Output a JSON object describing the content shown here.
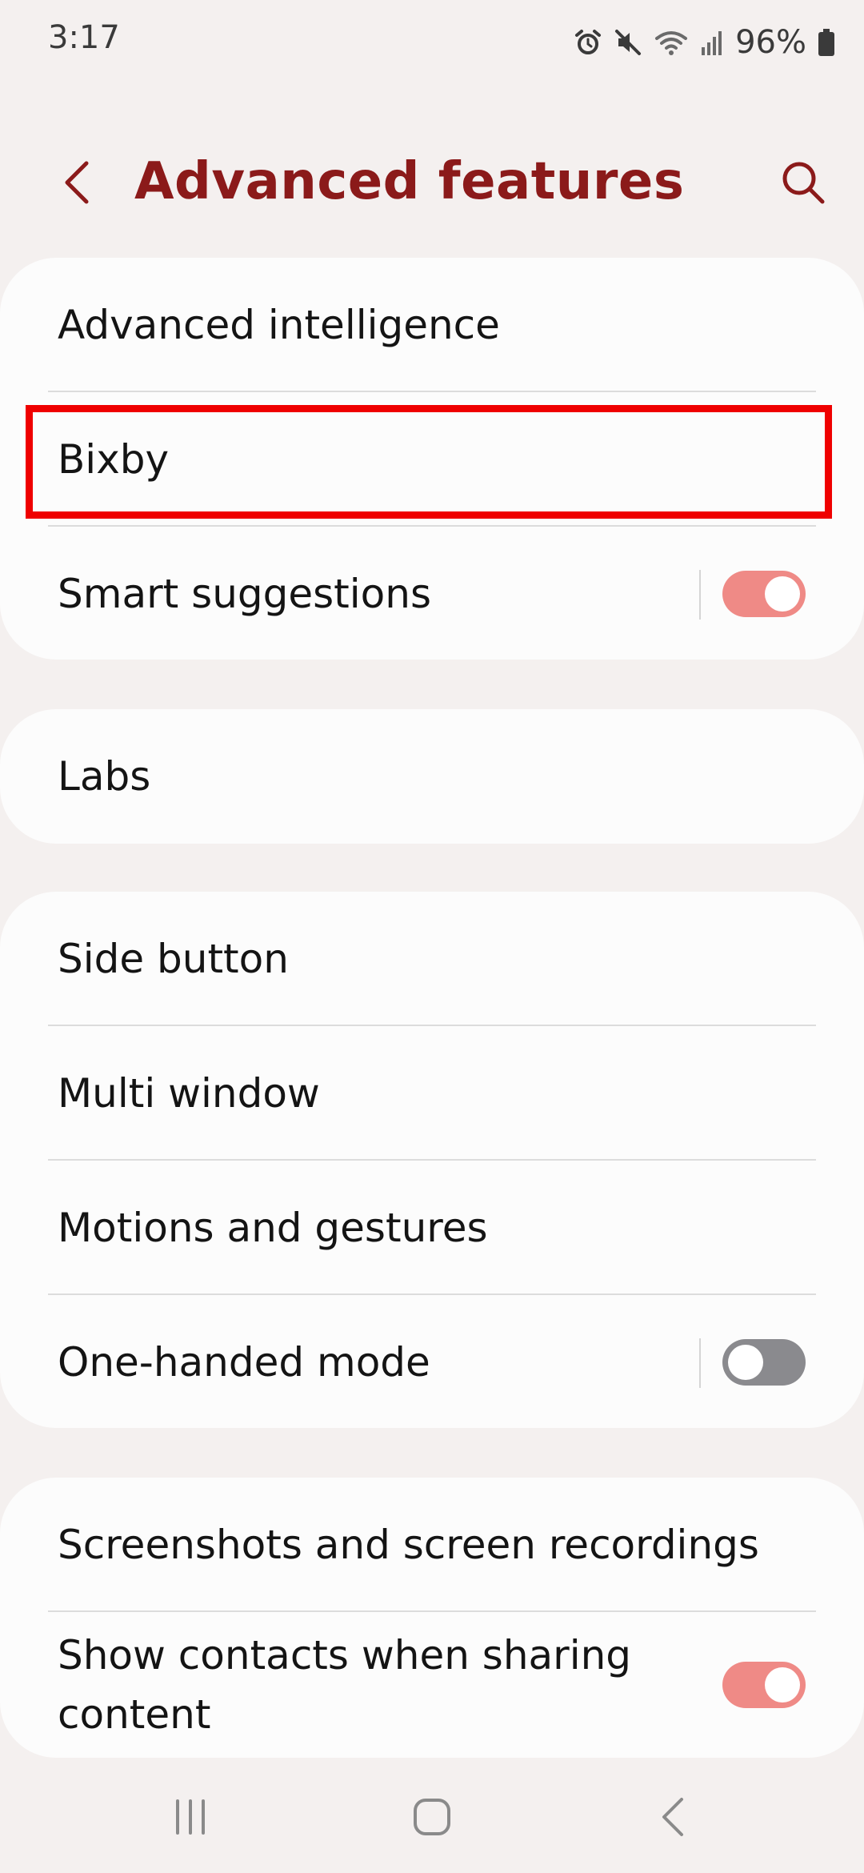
{
  "status_bar": {
    "time": "3:17",
    "battery": "96%",
    "icons": [
      "alarm-icon",
      "mute-icon",
      "wifi-icon",
      "signal-icon",
      "battery-icon"
    ]
  },
  "header": {
    "title": "Advanced features",
    "back_icon": "chevron-left-icon",
    "search_icon": "search-icon"
  },
  "groups": [
    {
      "items": [
        {
          "label": "Advanced intelligence"
        },
        {
          "label": "Bixby",
          "highlighted": true
        },
        {
          "label": "Smart suggestions",
          "toggle": "on"
        }
      ]
    },
    {
      "items": [
        {
          "label": "Labs"
        }
      ]
    },
    {
      "items": [
        {
          "label": "Side button"
        },
        {
          "label": "Multi window"
        },
        {
          "label": "Motions and gestures"
        },
        {
          "label": "One-handed mode",
          "toggle": "off"
        }
      ]
    },
    {
      "items": [
        {
          "label": "Screenshots and screen recordings"
        },
        {
          "label": "Show contacts when sharing content",
          "toggle": "on"
        }
      ]
    }
  ],
  "colors": {
    "accent": "#8b1a1a",
    "toggle_on": "#ef8a86",
    "toggle_off": "#8a8a8e",
    "highlight": "#ef0000",
    "background": "#f4f0ef",
    "card": "#fcfcfc"
  },
  "nav_bar": {
    "icons": [
      "recents-icon",
      "home-icon",
      "back-icon"
    ]
  }
}
